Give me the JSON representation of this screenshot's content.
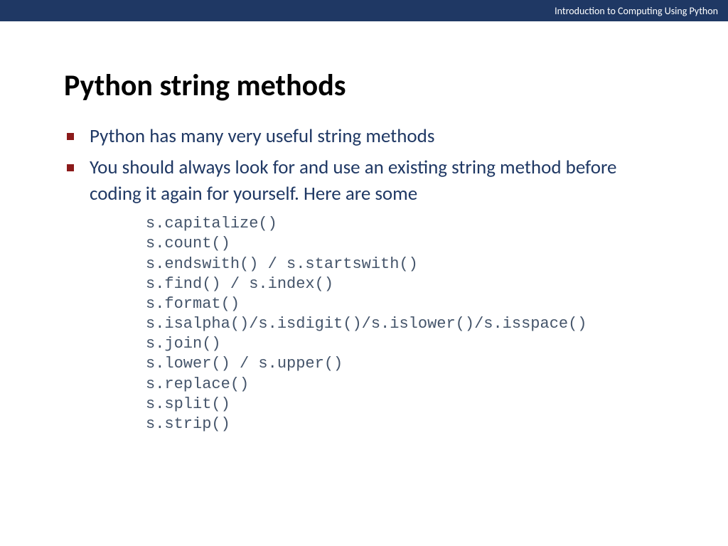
{
  "header": {
    "course_title": "Introduction to Computing Using Python"
  },
  "slide": {
    "title": "Python string methods",
    "bullets": [
      "Python has many very useful string methods",
      "You should always look for and use an existing string method before coding it again for yourself.  Here are some"
    ],
    "code_lines": [
      "s.capitalize()",
      "s.count()",
      "s.endswith() / s.startswith()",
      "s.find() / s.index()",
      "s.format()",
      "s.isalpha()/s.isdigit()/s.islower()/s.isspace()",
      "s.join()",
      "s.lower() / s.upper()",
      "s.replace()",
      "s.split()",
      "s.strip()"
    ]
  }
}
